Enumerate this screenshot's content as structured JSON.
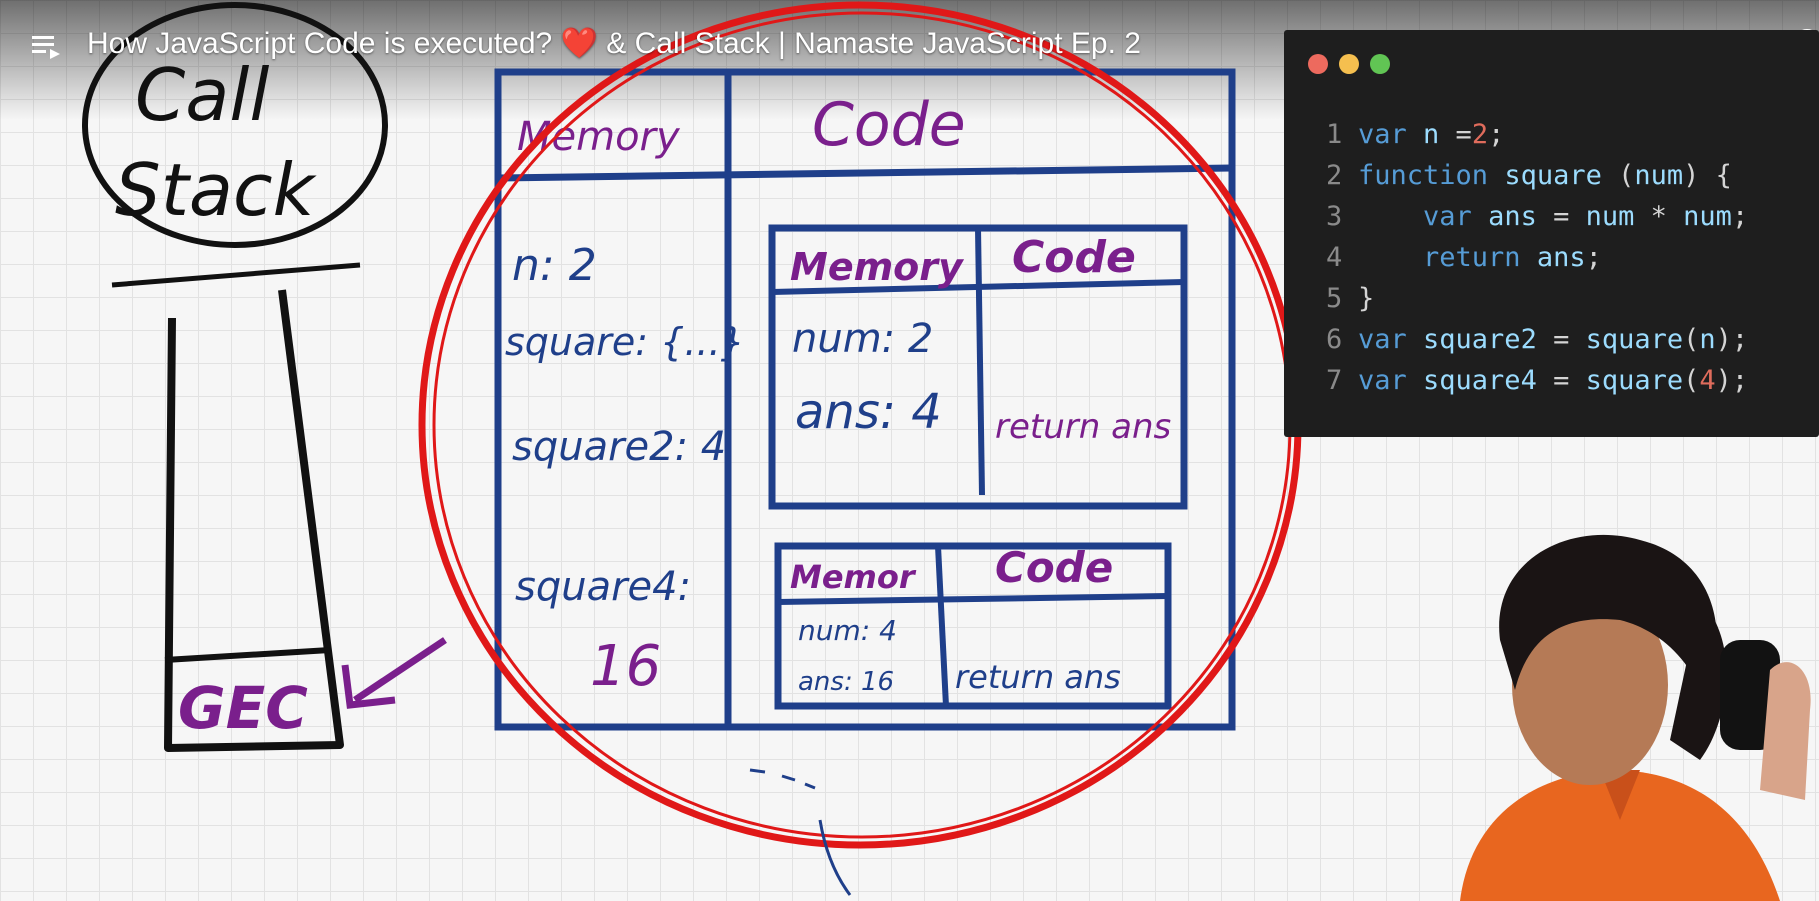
{
  "player": {
    "title_part1": "How JavaScript Code is executed?",
    "title_heart": "❤️",
    "title_part2": "& Call Stack | Namaste JavaScript Ep. 2",
    "icons": {
      "playlist": "playlist-icon",
      "watch_later": "clock-icon"
    }
  },
  "editor": {
    "dot_colors": [
      "#ed6a5e",
      "#f5bf4f",
      "#61c554"
    ],
    "lines": [
      {
        "n": "1",
        "tokens": [
          [
            "kw",
            "var "
          ],
          [
            "id",
            "n "
          ],
          [
            "pun",
            "="
          ],
          [
            "num",
            "2"
          ],
          [
            "pun",
            ";"
          ]
        ]
      },
      {
        "n": "2",
        "tokens": [
          [
            "kw",
            "function "
          ],
          [
            "fn",
            "square "
          ],
          [
            "pun",
            "("
          ],
          [
            "id",
            "num"
          ],
          [
            "pun",
            ") {"
          ]
        ]
      },
      {
        "n": "3",
        "tokens": [
          [
            "pun",
            "    "
          ],
          [
            "kw",
            "var "
          ],
          [
            "id",
            "ans "
          ],
          [
            "pun",
            "= "
          ],
          [
            "id",
            "num "
          ],
          [
            "pun",
            "* "
          ],
          [
            "id",
            "num"
          ],
          [
            "pun",
            ";"
          ]
        ]
      },
      {
        "n": "4",
        "tokens": [
          [
            "pun",
            "    "
          ],
          [
            "kw",
            "return "
          ],
          [
            "id",
            "ans"
          ],
          [
            "pun",
            ";"
          ]
        ]
      },
      {
        "n": "5",
        "tokens": [
          [
            "pun",
            "}"
          ]
        ]
      },
      {
        "n": "6",
        "tokens": [
          [
            "kw",
            "var "
          ],
          [
            "id",
            "square2 "
          ],
          [
            "pun",
            "= "
          ],
          [
            "fn",
            "square"
          ],
          [
            "pun",
            "("
          ],
          [
            "id",
            "n"
          ],
          [
            "pun",
            ");"
          ]
        ]
      },
      {
        "n": "7",
        "tokens": [
          [
            "kw",
            "var "
          ],
          [
            "id",
            "square4 "
          ],
          [
            "pun",
            "= "
          ],
          [
            "fn",
            "square"
          ],
          [
            "pun",
            "("
          ],
          [
            "num",
            "4"
          ],
          [
            "pun",
            ");"
          ]
        ]
      }
    ]
  },
  "drawing": {
    "call_stack_label_1": "Call",
    "call_stack_label_2": "Stack",
    "stack_item": "GEC",
    "global": {
      "memory_header": "Memory",
      "code_header": "Code",
      "entries": [
        "n: 2",
        "square: {...}",
        "square2: 4",
        "square4:",
        "16"
      ]
    },
    "ctx1": {
      "memory_header": "Memory",
      "code_header": "Code",
      "entries": [
        "num: 2",
        "ans: 4"
      ],
      "code": "return ans"
    },
    "ctx2": {
      "memory_header": "Memor",
      "code_header": "Code",
      "entries": [
        "num: 4",
        "ans: 16"
      ],
      "code": "return ans"
    },
    "colors": {
      "ink_blue": "#1f3f8a",
      "ink_purple": "#7a1f8c",
      "ink_black": "#111111",
      "circle_red": "#e01818"
    }
  }
}
